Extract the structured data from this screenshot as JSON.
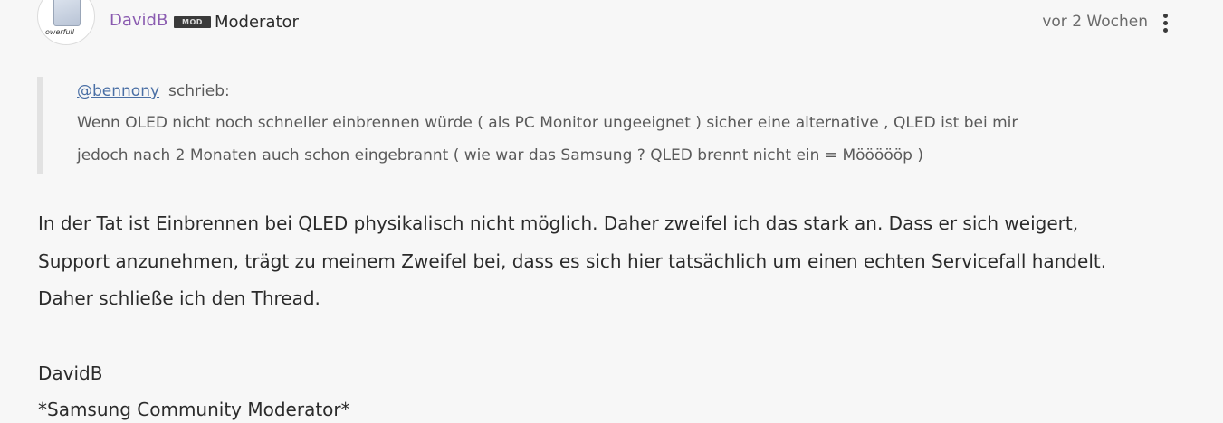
{
  "post": {
    "author": "DavidB",
    "badge": "MOD",
    "role": "Moderator",
    "timestamp": "vor 2 Wochen",
    "avatar_text": "owerfull"
  },
  "quote": {
    "mention": "@bennony",
    "wrote": "schrieb:",
    "lines": [
      "Wenn OLED nicht noch schneller einbrennen würde ( als PC Monitor ungeeignet ) sicher eine alternative , QLED ist bei mir",
      "jedoch nach 2 Monaten auch schon eingebrannt ( wie war das Samsung ?  QLED brennt nicht ein = Möööööp )"
    ]
  },
  "body": {
    "lines": [
      "In der Tat ist Einbrennen bei QLED physikalisch nicht möglich. Daher zweifel ich das stark an. Dass er sich weigert,",
      "Support anzunehmen, trägt zu meinem Zweifel bei, dass es sich hier tatsächlich um einen echten Servicefall handelt.",
      "Daher schließe ich den Thread."
    ],
    "signature": [
      "DavidB",
      "*Samsung Community Moderator*"
    ]
  },
  "icons": {
    "options": "kebab-menu-icon",
    "avatar": "avatar-image"
  },
  "colors": {
    "author": "#8a5bb0",
    "mention": "#4a6fa5",
    "badge_bg": "#3a3a3a"
  }
}
